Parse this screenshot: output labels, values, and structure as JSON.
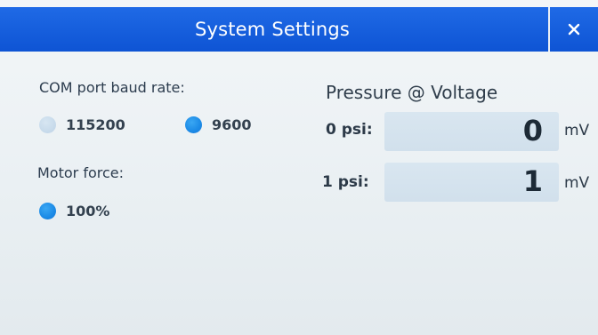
{
  "window": {
    "title": "System Settings"
  },
  "baud": {
    "label": "COM port baud rate:",
    "options": [
      {
        "label": "115200",
        "selected": false
      },
      {
        "label": "9600",
        "selected": true
      }
    ]
  },
  "motor": {
    "label": "Motor force:",
    "options": [
      {
        "label": "100%",
        "selected": true
      }
    ]
  },
  "pressure": {
    "title": "Pressure @ Voltage",
    "rows": [
      {
        "label": "0 psi:",
        "value": "0",
        "unit": "mV"
      },
      {
        "label": "1 psi:",
        "value": "1",
        "unit": "mV"
      }
    ]
  },
  "colors": {
    "titlebar": "#1463e0",
    "radio_selected": "#1b8ae6",
    "radio_unselected": "#c6dbeb",
    "field_bg": "#d5e3ee"
  }
}
